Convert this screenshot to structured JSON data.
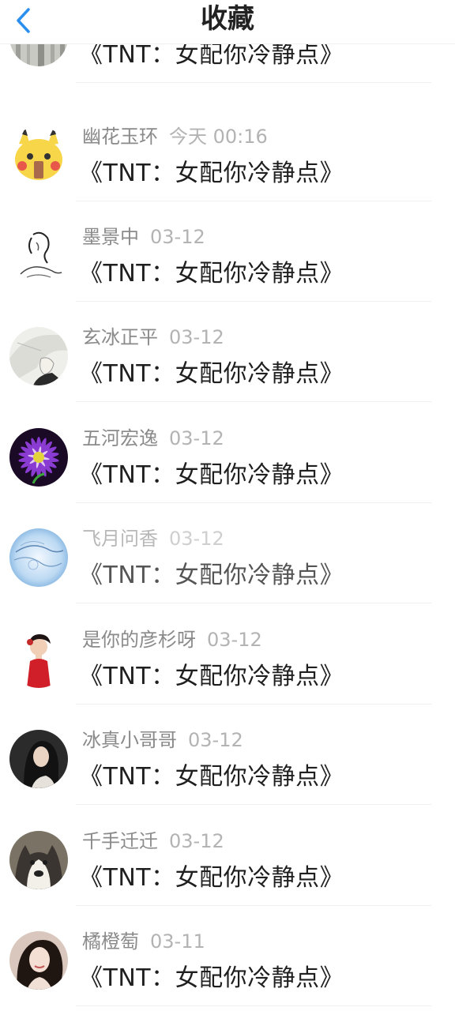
{
  "header": {
    "title": "收藏"
  },
  "items": [
    {
      "name": "",
      "time": "",
      "book": "《TNT：女配你冷静点》"
    },
    {
      "name": "幽花玉环",
      "time": "今天 00:16",
      "book": "《TNT：女配你冷静点》"
    },
    {
      "name": "墨景中",
      "time": "03-12",
      "book": "《TNT：女配你冷静点》"
    },
    {
      "name": "玄冰正平",
      "time": "03-12",
      "book": "《TNT：女配你冷静点》"
    },
    {
      "name": "五河宏逸",
      "time": "03-12",
      "book": "《TNT：女配你冷静点》"
    },
    {
      "name": "飞月问香",
      "time": "03-12",
      "book": "《TNT：女配你冷静点》"
    },
    {
      "name": "是你的彦杉呀",
      "time": "03-12",
      "book": "《TNT：女配你冷静点》"
    },
    {
      "name": "冰真小哥哥",
      "time": "03-12",
      "book": "《TNT：女配你冷静点》"
    },
    {
      "name": "千手迁迁",
      "time": "03-12",
      "book": "《TNT：女配你冷静点》"
    },
    {
      "name": "橘橙萄",
      "time": "03-11",
      "book": "《TNT：女配你冷静点》"
    }
  ]
}
